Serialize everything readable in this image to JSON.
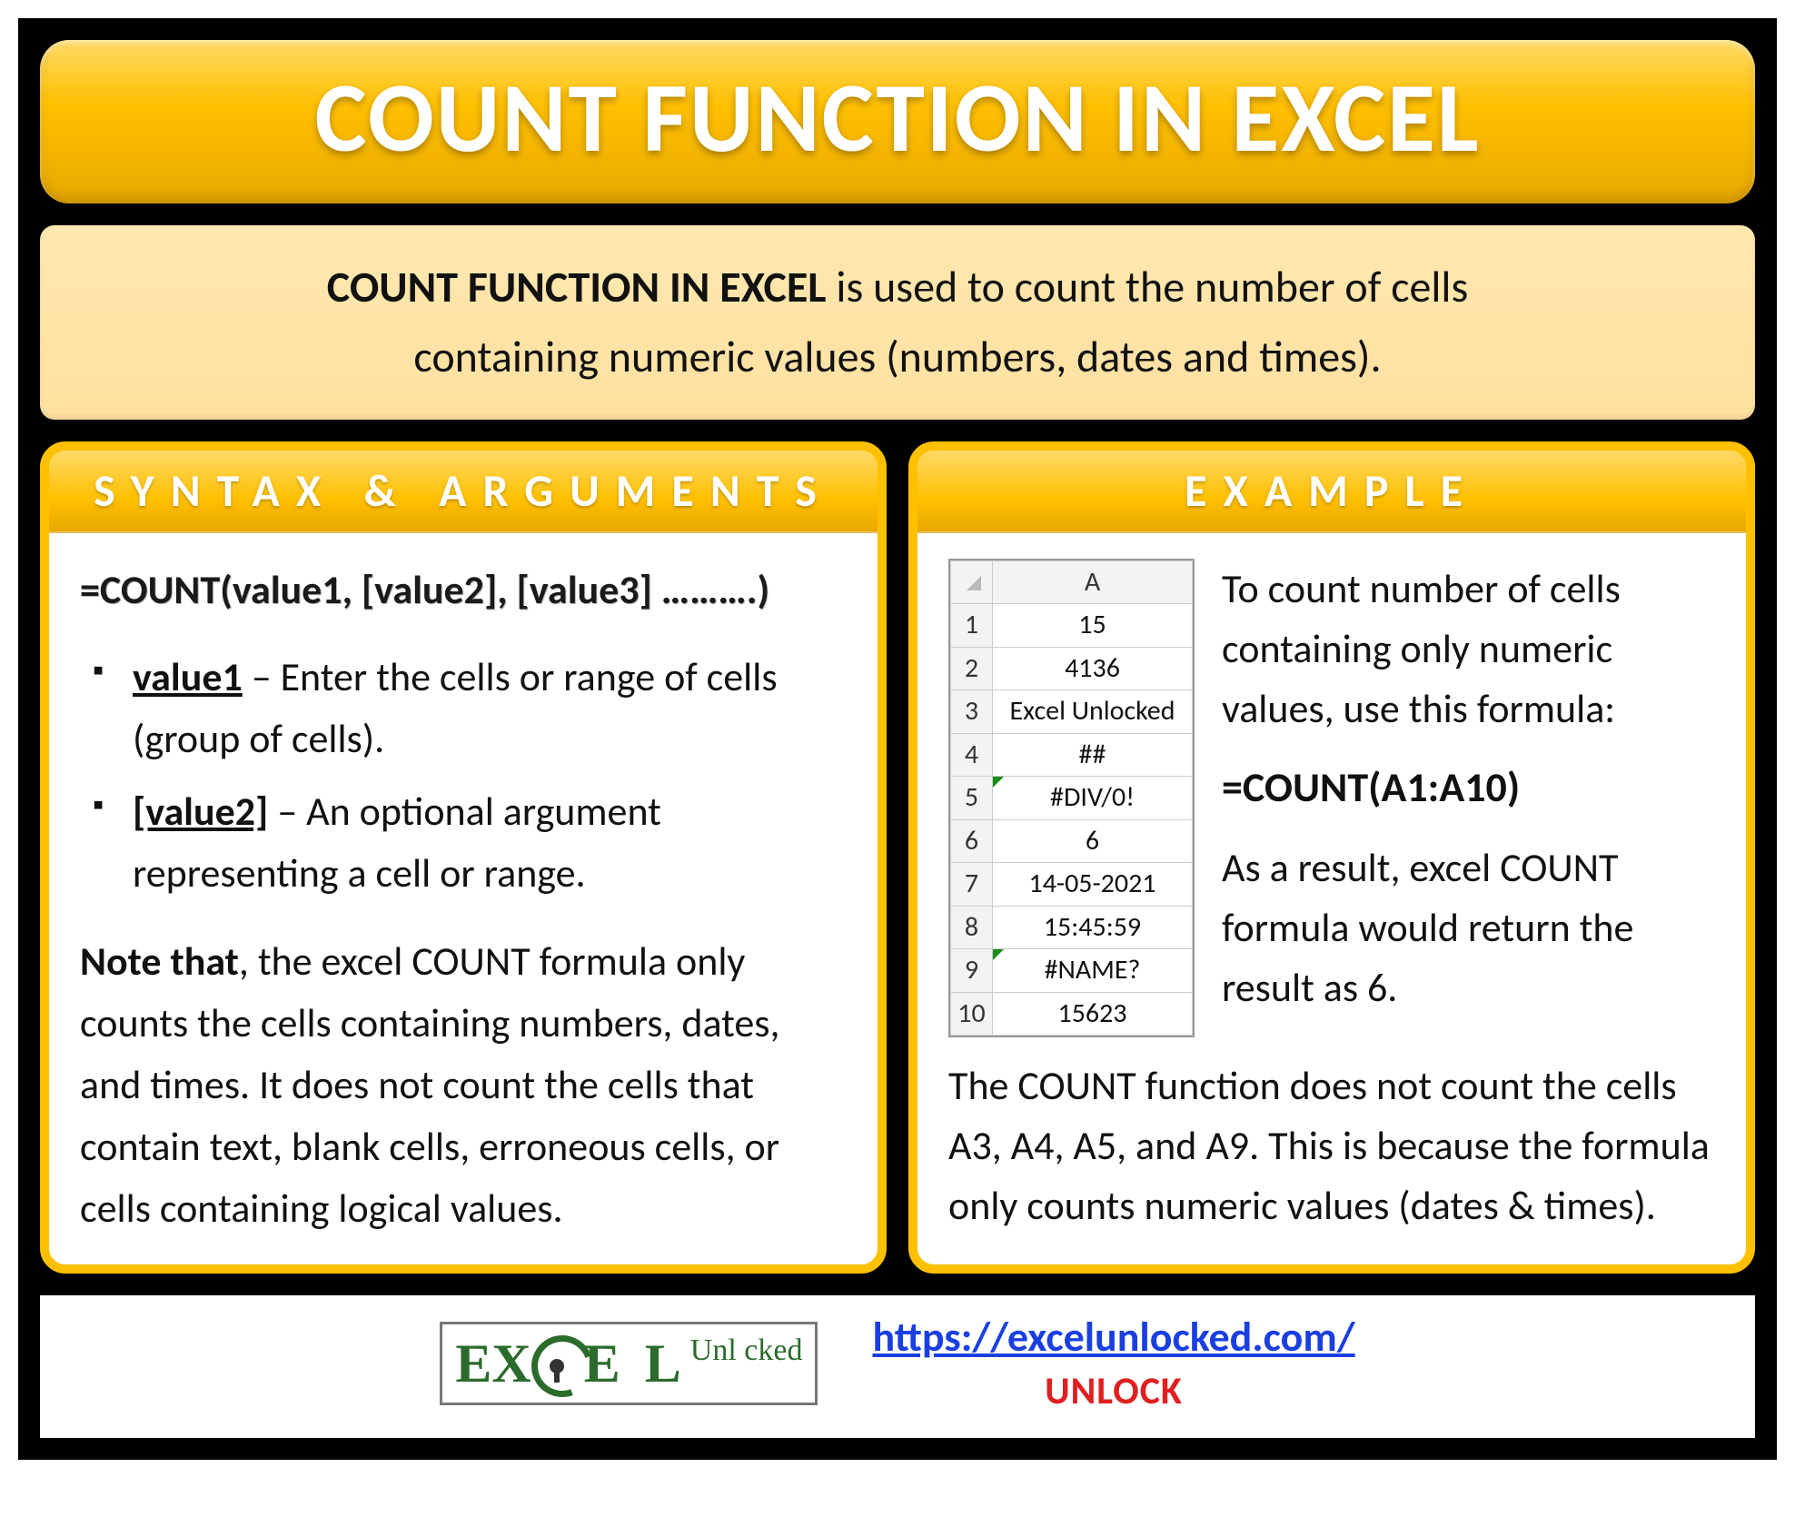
{
  "title": "COUNT FUNCTION IN EXCEL",
  "description": {
    "bold_lead": "COUNT FUNCTION IN EXCEL",
    "rest_line1": " is used to count the number of cells",
    "line2": "containing numeric values (numbers, dates and times)."
  },
  "syntax_panel": {
    "header": "SYNTAX & ARGUMENTS",
    "formula": "=COUNT(value1, [value2], [value3] ……….)",
    "args": [
      {
        "name": "value1",
        "text": " – Enter the cells or range of cells (group of cells)."
      },
      {
        "name": "[value2]",
        "text": " – An optional argument representing a cell or range."
      }
    ],
    "note_lead": "Note that",
    "note_text": ", the excel COUNT formula only counts the cells containing numbers, dates, and times. It does not count the cells that contain text, blank cells, erroneous cells, or cells containing logical values."
  },
  "example_panel": {
    "header": "EXAMPLE",
    "sheet": {
      "col_header": "A",
      "rows": [
        {
          "n": "1",
          "v": "15",
          "err": false
        },
        {
          "n": "2",
          "v": "4136",
          "err": false
        },
        {
          "n": "3",
          "v": "Excel Unlocked",
          "err": false
        },
        {
          "n": "4",
          "v": "##",
          "err": false
        },
        {
          "n": "5",
          "v": "#DIV/0!",
          "err": true
        },
        {
          "n": "6",
          "v": "6",
          "err": false
        },
        {
          "n": "7",
          "v": "14-05-2021",
          "err": false
        },
        {
          "n": "8",
          "v": "15:45:59",
          "err": false
        },
        {
          "n": "9",
          "v": "#NAME?",
          "err": true
        },
        {
          "n": "10",
          "v": "15623",
          "err": false
        }
      ]
    },
    "intro": "To count number of cells containing only numeric values, use this formula:",
    "formula": "=COUNT(A1:A10)",
    "result": "As a result, excel COUNT formula would return the result as 6.",
    "below": "The COUNT function does not count the cells A3, A4, A5, and A9. This is because the formula only counts numeric values (dates & times)."
  },
  "footer": {
    "logo_text_1": "E",
    "logo_text_2": "X",
    "logo_text_3": "E L",
    "logo_sub": "Unl   cked",
    "url": "https://excelunlocked.com/",
    "unlock": "UNLOCK"
  }
}
